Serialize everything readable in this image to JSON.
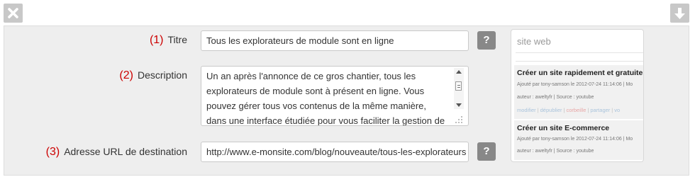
{
  "toolbar": {
    "close_icon": "close-icon",
    "down_icon": "arrow-down-icon",
    "colors": {
      "button_bg": "#c8c8c8",
      "icon": "#ffffff"
    }
  },
  "form": {
    "title": {
      "number": "(1)",
      "label": "Titre",
      "value": "Tous les explorateurs de module sont en ligne",
      "help": "?"
    },
    "description": {
      "number": "(2)",
      "label": "Description",
      "value": "Un an après l'annonce de ce gros chantier, tous les explorateurs de module sont à présent en ligne. Vous pouvez gérer tous vos contenus de la même manière, dans une interface  étudiée pour vous faciliter la gestion de votre"
    },
    "url": {
      "number": "(3)",
      "label": "Adresse URL de destination",
      "value": "http://www.e-monsite.com/blog/nouveaute/tous-les-explorateurs",
      "help": "?"
    },
    "colors": {
      "number": "#cc0000",
      "help_button": "#888888"
    }
  },
  "preview": {
    "site_label": "site web",
    "articles": [
      {
        "title": "Créer un site rapidement et gratuitement",
        "meta": "Ajouté par tony-samson le 2012-07-24 11:14:06 | Mo",
        "author_source": "auteur : aweltyfr | Source : youtube",
        "actions": [
          "modifier",
          "dépublier",
          "corbeille",
          "partager",
          "vo"
        ]
      },
      {
        "title": "Créer un site E-commerce",
        "meta": "Ajouté par tony-samson le 2012-07-24 11:14:06 | Mo",
        "author_source": "auteur : aweltyfr | Source : youtube"
      }
    ]
  }
}
